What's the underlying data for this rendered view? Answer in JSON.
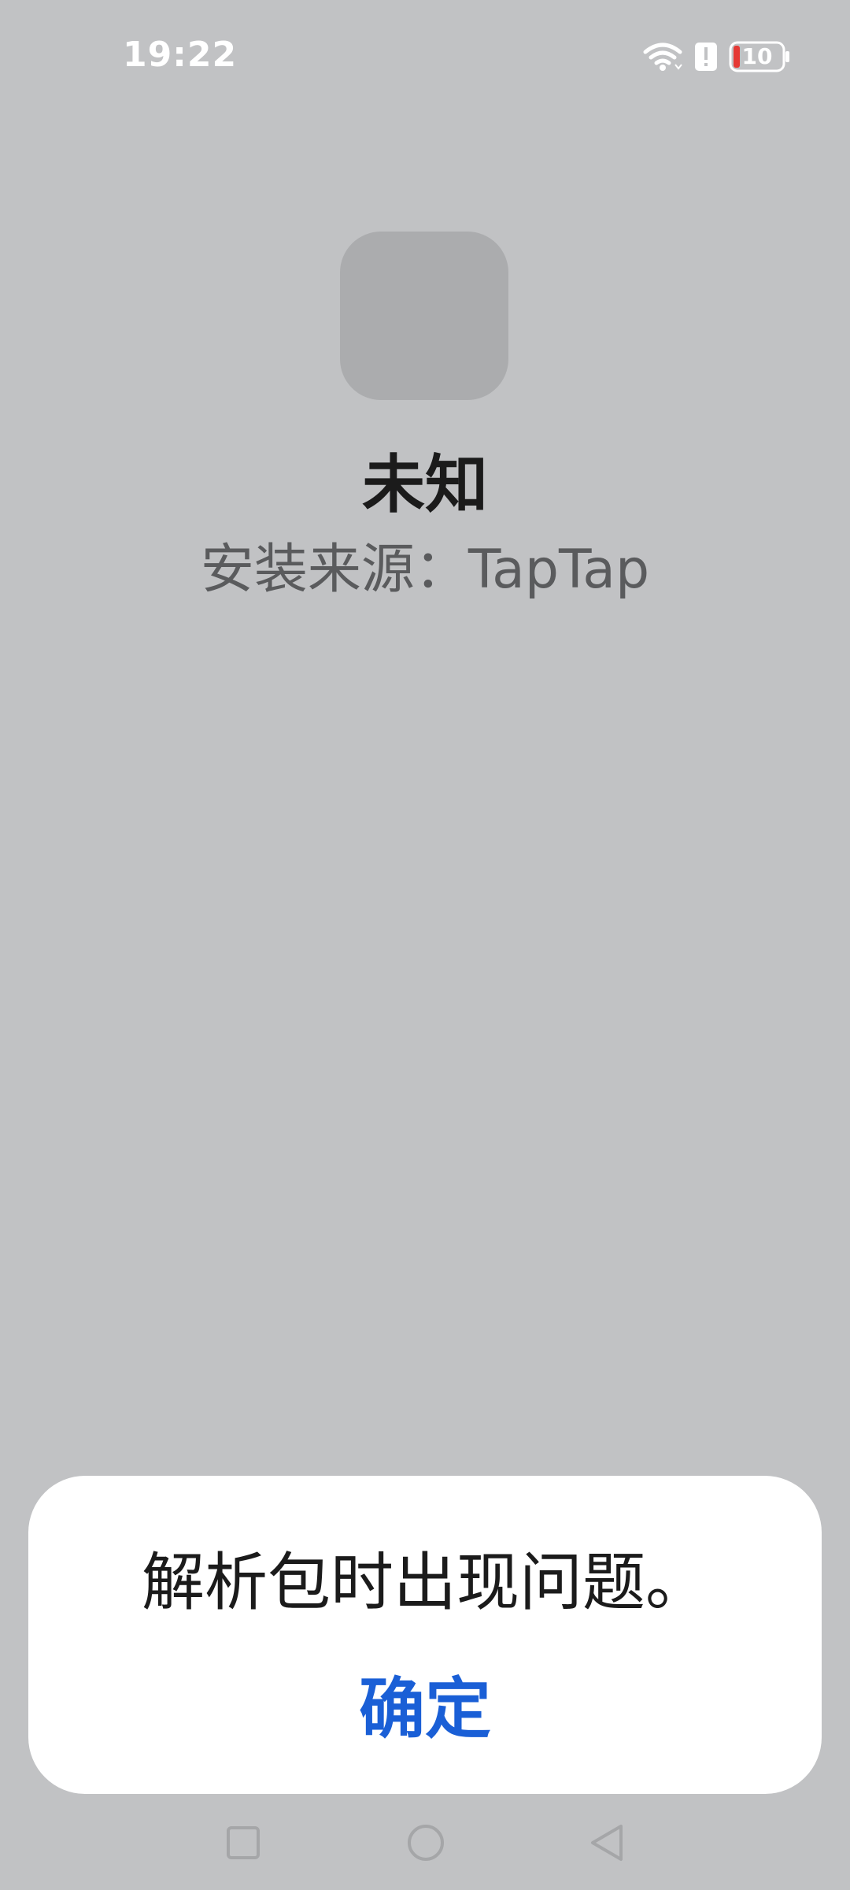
{
  "status_bar": {
    "time": "19:22",
    "battery_level": "10",
    "icons": [
      "wifi-icon",
      "alert-icon",
      "battery-icon"
    ]
  },
  "app": {
    "name": "未知",
    "install_source": "安装来源：TapTap"
  },
  "dialog": {
    "message": "解析包时出现问题。",
    "confirm_label": "确定"
  },
  "nav_bar": {
    "icons": [
      "recent-apps-icon",
      "home-icon",
      "back-icon"
    ]
  },
  "colors": {
    "background": "#c1c2c4",
    "dialog_background": "#ffffff",
    "accent": "#1a5fd6",
    "battery_low": "#e53935"
  }
}
